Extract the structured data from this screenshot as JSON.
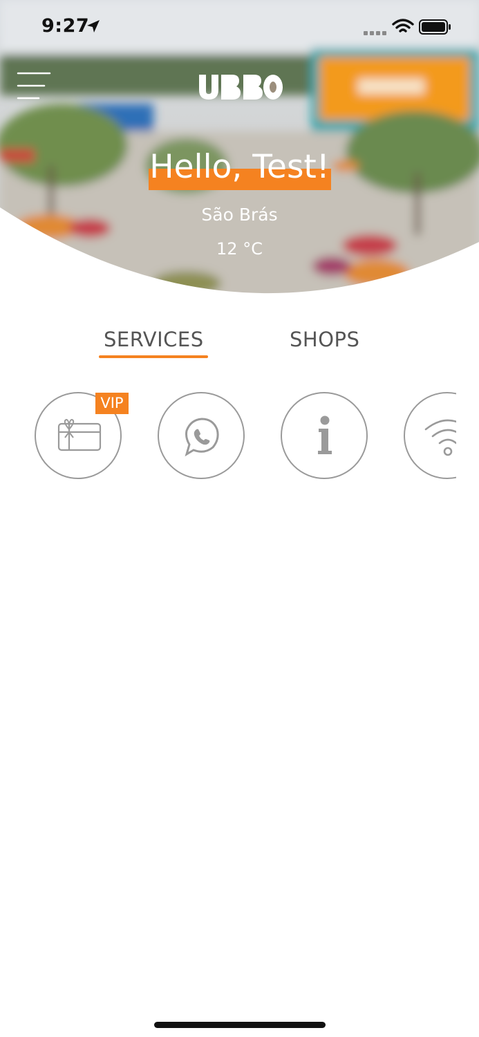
{
  "status_bar": {
    "time": "9:27",
    "icons": [
      "location-arrow-icon",
      "signal-icon",
      "wifi-icon",
      "battery-icon"
    ]
  },
  "header": {
    "menu_icon": "hamburger-menu-icon",
    "logo_text": "UBBO"
  },
  "hero": {
    "greeting": "Hello, Test!",
    "location": "São Brás",
    "temperature": "12 °C"
  },
  "tabs": [
    {
      "label": "SERVICES",
      "active": true
    },
    {
      "label": "SHOPS",
      "active": false
    }
  ],
  "services": [
    {
      "icon": "gift-card-icon",
      "badge": "VIP"
    },
    {
      "icon": "whatsapp-icon"
    },
    {
      "icon": "info-icon"
    },
    {
      "icon": "wifi-icon"
    }
  ],
  "colors": {
    "accent": "#f58220",
    "text": "#555555",
    "icon_gray": "#9a9a9a"
  }
}
